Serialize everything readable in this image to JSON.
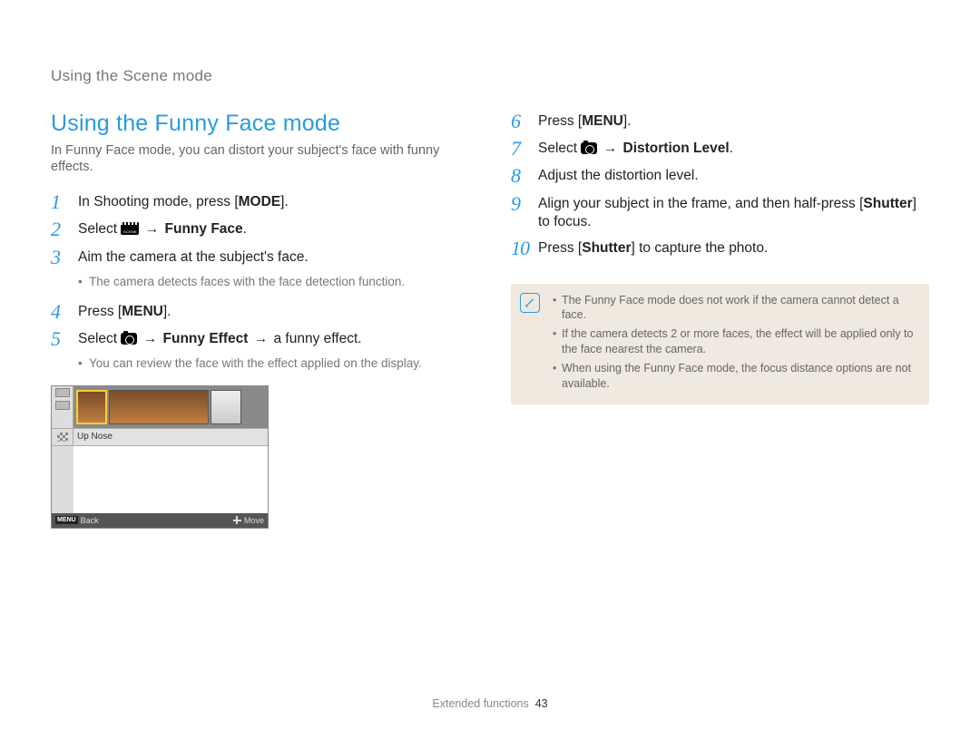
{
  "running_head": "Using the Scene mode",
  "section_title": "Using the Funny Face mode",
  "intro": "In Funny Face mode, you can distort your subject's face with funny effects.",
  "steps_left": {
    "1": {
      "pre": "In Shooting mode, press [",
      "btn": "MODE",
      "post": "]."
    },
    "2": {
      "pre": "Select ",
      "icon": "movie",
      "arrow": "→",
      "bold": "Funny Face",
      "post": "."
    },
    "3": {
      "text": "Aim the camera at the subject's face.",
      "bullet": "The camera detects faces with the face detection function."
    },
    "4": {
      "pre": "Press [",
      "btn": "MENU",
      "post": "]."
    },
    "5": {
      "pre": "Select ",
      "icon": "camera",
      "arrow1": "→",
      "bold": "Funny Effect",
      "arrow2": "→",
      "tail": " a funny effect.",
      "bullet": "You can review the face with the effect applied on the display."
    }
  },
  "steps_right": {
    "6": {
      "pre": "Press [",
      "btn": "MENU",
      "post": "]."
    },
    "7": {
      "pre": "Select ",
      "icon": "camera",
      "arrow": "→",
      "bold": "Distortion Level",
      "post": "."
    },
    "8": {
      "text": "Adjust the distortion level."
    },
    "9": {
      "pre": "Align your subject in the frame, and then half-press [",
      "bold": "Shutter",
      "post": "] to focus."
    },
    "10": {
      "pre": "Press [",
      "bold": "Shutter",
      "post": "] to capture the photo."
    }
  },
  "device": {
    "effect_label": "Up Nose",
    "back": "Back",
    "move": "Move",
    "menu": "MENU"
  },
  "notes": [
    "The Funny Face mode does not work if the camera cannot detect a face.",
    "If the camera detects 2 or more faces, the effect will be applied only to the face nearest the camera.",
    "When using the Funny Face mode, the focus distance options are not available."
  ],
  "footer": {
    "section": "Extended functions",
    "page": "43"
  }
}
